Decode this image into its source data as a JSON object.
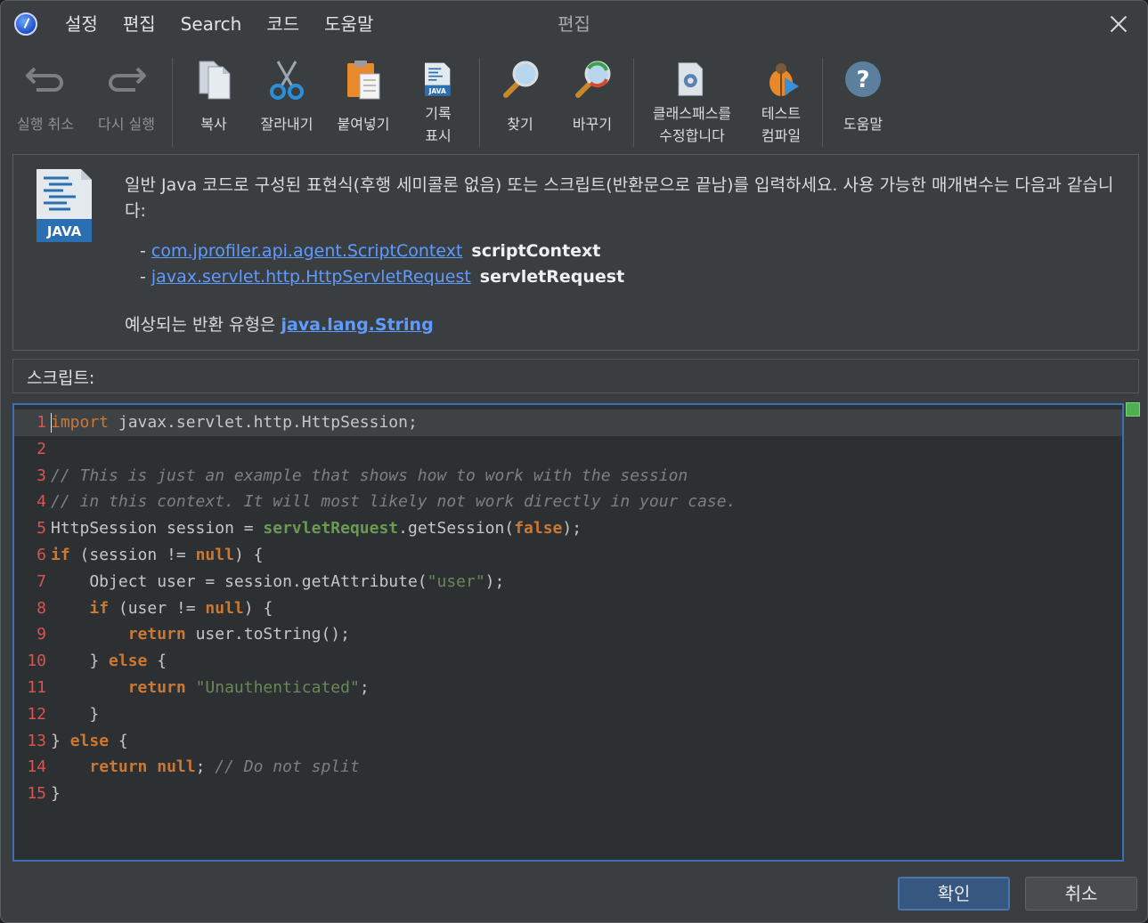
{
  "window": {
    "title": "편집"
  },
  "menu": [
    "설정",
    "편집",
    "Search",
    "코드",
    "도움말"
  ],
  "toolbar": {
    "undo": "실행 취소",
    "redo": "다시 실행",
    "copy": "복사",
    "cut": "잘라내기",
    "paste": "붙여넣기",
    "record_line1": "기록",
    "record_line2": "표시",
    "find": "찾기",
    "replace": "바꾸기",
    "classpath_line1": "클래스패스를",
    "classpath_line2": "수정합니다",
    "compile_line1": "테스트",
    "compile_line2": "컴파일",
    "help": "도움말"
  },
  "info": {
    "icon_label": "JAVA",
    "description": "일반 Java 코드로 구성된 표현식(후행 세미콜론 없음) 또는 스크립트(반환문으로 끝남)를 입력하세요. 사용 가능한 매개변수는 다음과 같습니다:",
    "params": [
      {
        "type": "com.jprofiler.api.agent.ScriptContext",
        "name": "scriptContext"
      },
      {
        "type": "javax.servlet.http.HttpServletRequest",
        "name": "servletRequest"
      }
    ],
    "return_prefix": "예상되는 반환 유형은 ",
    "return_type": "java.lang.String"
  },
  "script_label": "스크립트:",
  "code": {
    "line_numbers": [
      "1",
      "2",
      "3",
      "4",
      "5",
      "6",
      "7",
      "8",
      "9",
      "10",
      "11",
      "12",
      "13",
      "14",
      "15"
    ],
    "lines": [
      "import javax.servlet.http.HttpSession;",
      "",
      "// This is just an example that shows how to work with the session",
      "// in this context. It will most likely not work directly in your case.",
      "HttpSession session = servletRequest.getSession(false);",
      "if (session != null) {",
      "    Object user = session.getAttribute(\"user\");",
      "    if (user != null) {",
      "        return user.toString();",
      "    } else {",
      "        return \"Unauthenticated\";",
      "    }",
      "} else {",
      "    return null; // Do not split",
      "}"
    ]
  },
  "buttons": {
    "ok": "확인",
    "cancel": "취소"
  },
  "colors": {
    "background": "#3b3e40",
    "editor_background": "#2d3033",
    "keyword": "#cc7832",
    "string": "#6a8759",
    "comment": "#7f7f7f",
    "line_number": "#d9534f",
    "link": "#5e9bff",
    "accent": "#3f6fb8"
  }
}
